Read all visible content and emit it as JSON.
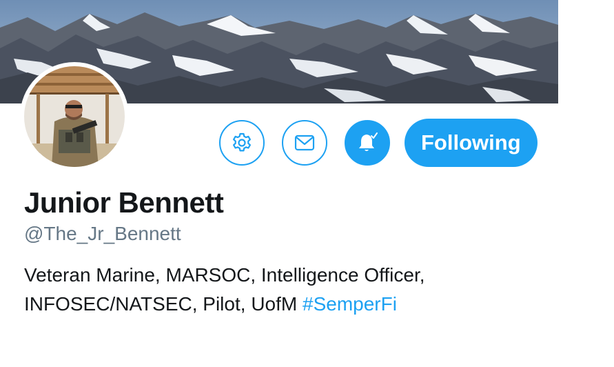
{
  "profile": {
    "name": "Junior Bennett",
    "handle": "@The_Jr_Bennett",
    "bio_line1": "Veteran Marine, MARSOC, Intelligence Officer,",
    "bio_line2_text": "INFOSEC/NATSEC, Pilot, UofM ",
    "bio_hashtag": "#SemperFi"
  },
  "actions": {
    "settings_icon": "gear-icon",
    "message_icon": "envelope-icon",
    "notify_icon": "bell-check-icon",
    "follow_label": "Following"
  },
  "colors": {
    "accent": "#1da1f2",
    "name_text": "#14171a",
    "secondary_text": "#657786"
  }
}
